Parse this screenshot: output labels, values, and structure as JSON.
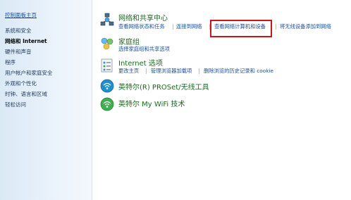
{
  "sidebar": {
    "home": "控制面板主页",
    "items": [
      {
        "label": "系统和安全",
        "active": false
      },
      {
        "label": "网络和 Internet",
        "active": true
      },
      {
        "label": "硬件和声音",
        "active": false
      },
      {
        "label": "程序",
        "active": false
      },
      {
        "label": "用户帐户和家庭安全",
        "active": false
      },
      {
        "label": "外观和个性化",
        "active": false
      },
      {
        "label": "时钟、语言和区域",
        "active": false
      },
      {
        "label": "轻松访问",
        "active": false
      }
    ]
  },
  "sections": [
    {
      "title": "网络和共享中心",
      "icon": "network-center-icon",
      "links": [
        "查看网络状态和任务",
        "连接到网络",
        "查看网络计算机和设备",
        "将无线设备添加到网络"
      ]
    },
    {
      "title": "家庭组",
      "icon": "homegroup-icon",
      "links": [
        "选择家庭组和共享选项"
      ]
    },
    {
      "title": "Internet 选项",
      "icon": "internet-options-icon",
      "links": [
        "更改主页",
        "管理浏览器加载项",
        "删除浏览的历史记录和 cookie"
      ]
    },
    {
      "title": "英特尔(R) PROSet/无线工具",
      "icon": "intel-wireless-icon",
      "links": []
    },
    {
      "title": "英特尔 My WiFi 技术",
      "icon": "intel-mywifi-icon",
      "links": []
    }
  ],
  "colors": {
    "title_green": "#1c6a22",
    "link_blue": "#1a4f9c",
    "highlight_red": "#c8161d"
  }
}
